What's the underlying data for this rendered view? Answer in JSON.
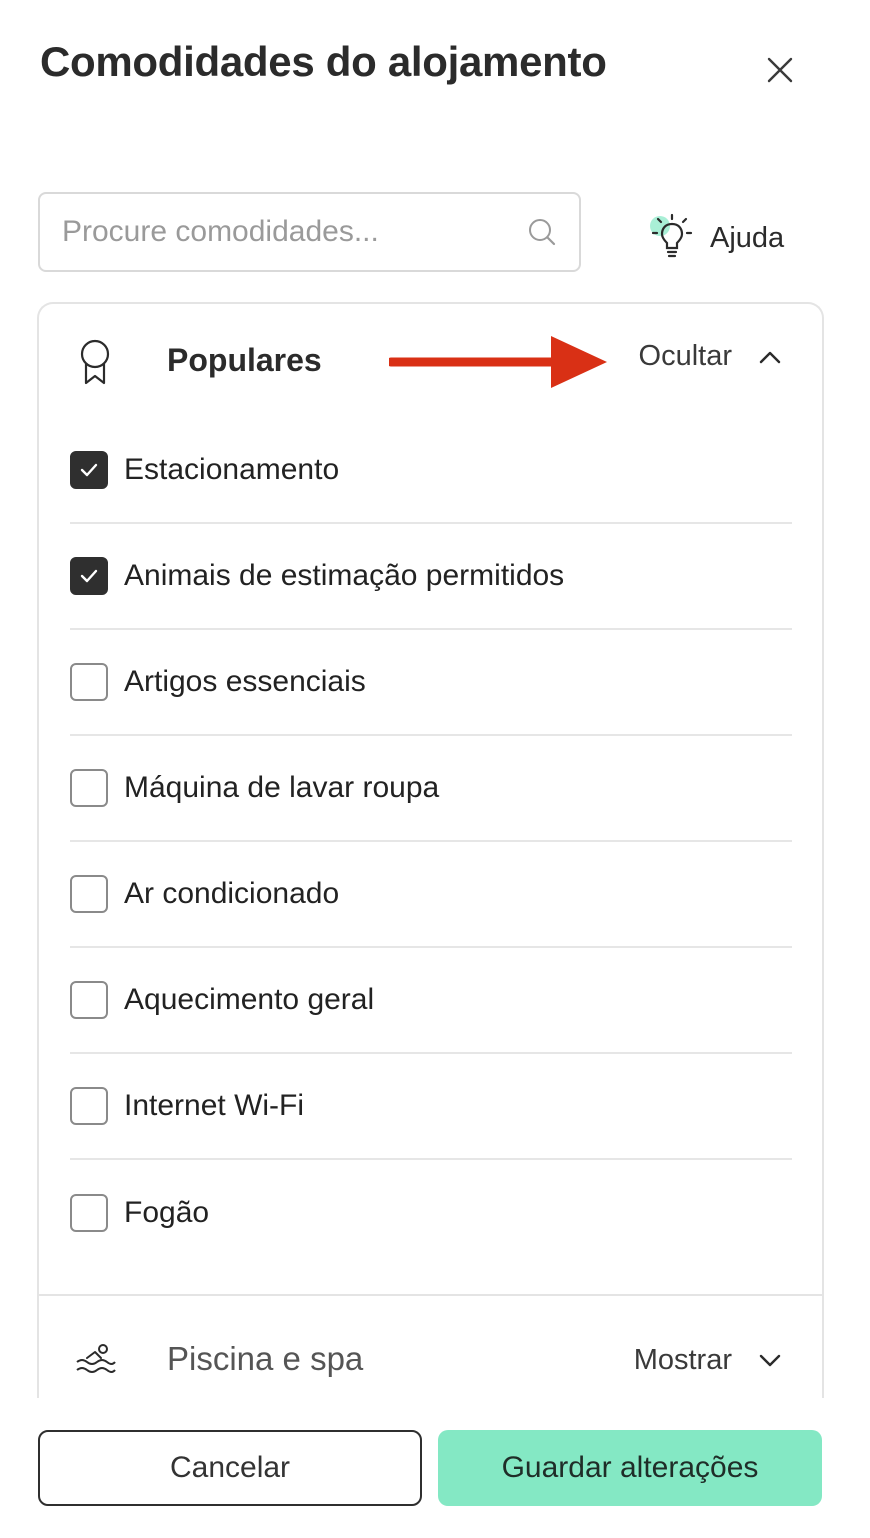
{
  "title": "Comodidades do alojamento",
  "search": {
    "placeholder": "Procure comodidades..."
  },
  "help": {
    "label": "Ajuda"
  },
  "popular": {
    "title": "Populares",
    "toggle_label": "Ocultar",
    "items": [
      {
        "label": "Estacionamento",
        "checked": true
      },
      {
        "label": "Animais de estimação permitidos",
        "checked": true
      },
      {
        "label": "Artigos essenciais",
        "checked": false
      },
      {
        "label": "Máquina de lavar roupa",
        "checked": false
      },
      {
        "label": "Ar condicionado",
        "checked": false
      },
      {
        "label": "Aquecimento geral",
        "checked": false
      },
      {
        "label": "Internet Wi-Fi",
        "checked": false
      },
      {
        "label": "Fogão",
        "checked": false
      }
    ]
  },
  "pool": {
    "title": "Piscina e spa",
    "toggle_label": "Mostrar"
  },
  "footer": {
    "cancel_label": "Cancelar",
    "save_label": "Guardar alterações"
  },
  "colors": {
    "accent": "#84e8c4",
    "annotation_arrow": "#d93015",
    "checkbox_checked": "#2f2f2f"
  },
  "icons": {
    "close": "close-icon",
    "search": "search-icon",
    "help": "lightbulb-icon",
    "popular": "ribbon-badge-icon",
    "pool": "swimming-icon",
    "collapse": "chevron-up-icon",
    "expand": "chevron-down-icon"
  }
}
